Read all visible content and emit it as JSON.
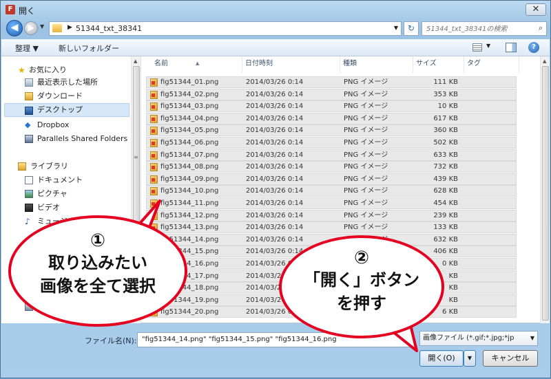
{
  "window": {
    "app_icon_letter": "F",
    "title": "開く",
    "close_glyph": "✕"
  },
  "navbar": {
    "back_glyph": "◀",
    "forward_glyph": "▶",
    "path_separator": "▶",
    "path": "51344_txt_38341",
    "refresh_glyph": "↻",
    "search_placeholder": "51344_txt_38341の検索"
  },
  "toolbar": {
    "organize_label": "整理 ▼",
    "new_folder_label": "新しいフォルダー",
    "help_glyph": "?"
  },
  "sidebar": {
    "favorites_label": "お気に入り",
    "items": [
      {
        "label": "最近表示した場所"
      },
      {
        "label": "ダウンロード"
      },
      {
        "label": "デスクトップ"
      },
      {
        "label": "Dropbox"
      },
      {
        "label": "Parallels Shared Folders"
      }
    ],
    "library_label": "ライブラリ",
    "library_items": [
      {
        "label": "ドキュメント"
      },
      {
        "label": "ピクチャ"
      },
      {
        "label": "ビデオ"
      },
      {
        "label": "ミュージック"
      }
    ],
    "partial_item_label": "TO"
  },
  "columns": {
    "name": "名前",
    "date": "日付時刻",
    "type": "種類",
    "size": "サイズ",
    "tag": "タグ"
  },
  "files": [
    {
      "name": "fig51344_01.png",
      "date": "2014/03/26 0:14",
      "type": "PNG イメージ",
      "size": "111 KB"
    },
    {
      "name": "fig51344_02.png",
      "date": "2014/03/26 0:14",
      "type": "PNG イメージ",
      "size": "353 KB"
    },
    {
      "name": "fig51344_03.png",
      "date": "2014/03/26 0:14",
      "type": "PNG イメージ",
      "size": "10 KB"
    },
    {
      "name": "fig51344_04.png",
      "date": "2014/03/26 0:14",
      "type": "PNG イメージ",
      "size": "617 KB"
    },
    {
      "name": "fig51344_05.png",
      "date": "2014/03/26 0:14",
      "type": "PNG イメージ",
      "size": "360 KB"
    },
    {
      "name": "fig51344_06.png",
      "date": "2014/03/26 0:14",
      "type": "PNG イメージ",
      "size": "502 KB"
    },
    {
      "name": "fig51344_07.png",
      "date": "2014/03/26 0:14",
      "type": "PNG イメージ",
      "size": "633 KB"
    },
    {
      "name": "fig51344_08.png",
      "date": "2014/03/26 0:14",
      "type": "PNG イメージ",
      "size": "732 KB"
    },
    {
      "name": "fig51344_09.png",
      "date": "2014/03/26 0:14",
      "type": "PNG イメージ",
      "size": "439 KB"
    },
    {
      "name": "fig51344_10.png",
      "date": "2014/03/26 0:14",
      "type": "PNG イメージ",
      "size": "628 KB"
    },
    {
      "name": "fig51344_11.png",
      "date": "2014/03/26 0:14",
      "type": "PNG イメージ",
      "size": "454 KB"
    },
    {
      "name": "fig51344_12.png",
      "date": "2014/03/26 0:14",
      "type": "PNG イメージ",
      "size": "239 KB"
    },
    {
      "name": "fig51344_13.png",
      "date": "2014/03/26 0:14",
      "type": "PNG イメージ",
      "size": "133 KB"
    },
    {
      "name": "fig51344_14.png",
      "date": "2014/03/26 0:14",
      "type": "PNG イメージ",
      "size": "632 KB"
    },
    {
      "name": "fig51344_15.png",
      "date": "2014/03/26 0:14",
      "type": "PNG イメージ",
      "size": "406 KB"
    },
    {
      "name": "fig51344_16.png",
      "date": "2014/03/26 0:14",
      "type": "PNG イメージ",
      "size": "0 KB"
    },
    {
      "name": "fig51344_17.png",
      "date": "2014/03/26 0:14",
      "type": "PNG イメージ",
      "size": "KB"
    },
    {
      "name": "fig51344_18.png",
      "date": "2014/03/26 0:14",
      "type": "PNG イメージ",
      "size": "KB"
    },
    {
      "name": "fig51344_19.png",
      "date": "2014/03/26 0:14",
      "type": "PNG イメージ",
      "size": "KB"
    },
    {
      "name": "fig51344_20.png",
      "date": "2014/03/26 0:14",
      "type": "PNG イメージ",
      "size": "6 KB"
    }
  ],
  "footer": {
    "filename_label": "ファイル名(N):",
    "filename_value": "\"fig51344_14.png\" \"fig51344_15.png\" \"fig51344_16.png",
    "filetype_value": "画像ファイル (*.gif;*.jpg;*jp",
    "open_label": "開く(O)",
    "cancel_label": "キャンセル"
  },
  "callouts": {
    "one_num": "①",
    "one_line1": "取り込みたい",
    "one_line2": "画像を全て選択",
    "two_num": "②",
    "two_line1": "「開く」ボタン",
    "two_line2": "を押す"
  },
  "colors": {
    "accent_red": "#e5001f"
  }
}
